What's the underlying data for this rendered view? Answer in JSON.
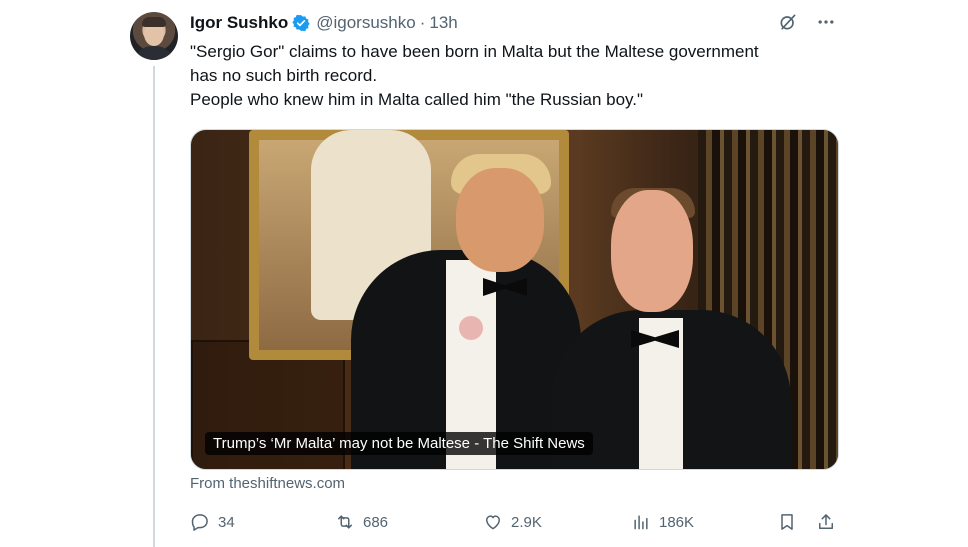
{
  "author": {
    "name": "Igor Sushko",
    "handle": "@igorsushko",
    "separator": "·",
    "time": "13h",
    "verified_color": "#1d9bf0"
  },
  "tweet": {
    "lines": [
      "\"Sergio Gor\" claims to have been born in Malta but the Maltese government",
      "has no such birth record.",
      "People who knew him in Malta called him \"the Russian boy.\""
    ]
  },
  "media": {
    "caption": "Trump’s ‘Mr Malta’ may not be Maltese - The Shift News"
  },
  "source": "From theshiftnews.com",
  "actions": {
    "replies": "34",
    "reposts": "686",
    "likes": "2.9K",
    "views": "186K"
  },
  "icons": {
    "grok": "grok-icon",
    "more": "more-icon",
    "reply": "reply-icon",
    "repost": "repost-icon",
    "like": "like-icon",
    "views": "views-icon",
    "bookmark": "bookmark-icon",
    "share": "share-icon"
  },
  "colors": {
    "text": "#0f1419",
    "secondary": "#536471",
    "border": "#cfd9de"
  }
}
